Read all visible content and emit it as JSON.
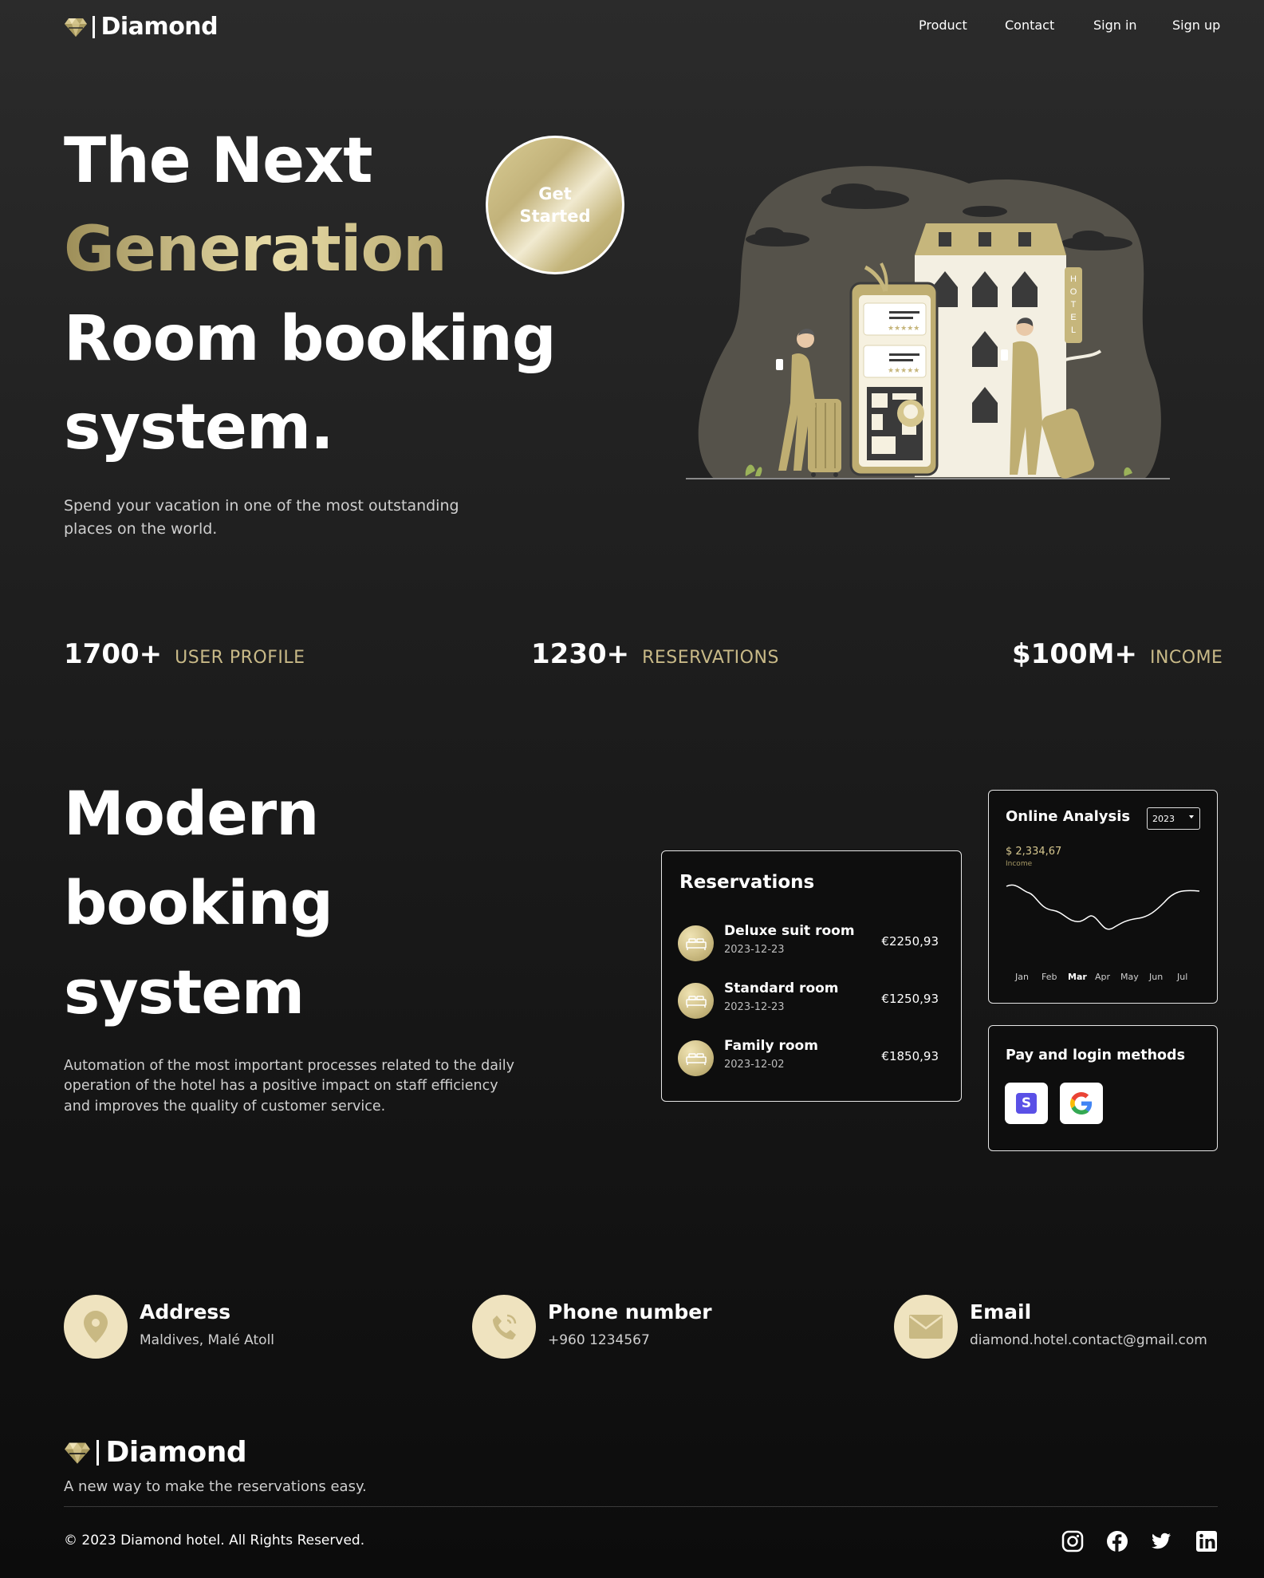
{
  "nav": {
    "brand": "Diamond",
    "links": [
      "Product",
      "Contact",
      "Sign in",
      "Sign up"
    ]
  },
  "hero": {
    "line1": "The Next",
    "line2": "Generation",
    "line3": "Room booking",
    "line4": "system.",
    "cta": "Get Started",
    "subtitle_line1": "Spend your vacation in one of the most outstanding",
    "subtitle_line2": "places on the world.",
    "illustration_sign": "HOTEL"
  },
  "stats": [
    {
      "value": "1700+",
      "label": "USER PROFILE"
    },
    {
      "value": "1230+",
      "label": "RESERVATIONS"
    },
    {
      "value": "$100M+",
      "label": "INCOME"
    }
  ],
  "features": {
    "line1": "Modern",
    "line2": "booking",
    "line3": "system",
    "desc_line1": "Automation of the most important processes related to the daily",
    "desc_line2": "operation of the hotel has a positive impact on staff efficiency",
    "desc_line3": "and improves the quality of customer service."
  },
  "reservations": {
    "title": "Reservations",
    "items": [
      {
        "name": "Deluxe suit room",
        "date": "2023-12-23",
        "price": "€2250,93"
      },
      {
        "name": "Standard room",
        "date": "2023-12-23",
        "price": "€1250,93"
      },
      {
        "name": "Family room",
        "date": "2023-12-02",
        "price": "€1850,93"
      }
    ]
  },
  "analysis": {
    "title": "Online Analysis",
    "year": "2023",
    "amount": "$ 2,334,67",
    "amount_label": "Income",
    "months": [
      "Jan",
      "Feb",
      "Mar",
      "Apr",
      "May",
      "Jun",
      "Jul"
    ],
    "active_month": "Mar"
  },
  "payments": {
    "title": "Pay and login methods",
    "methods": [
      "stripe-icon",
      "google-icon"
    ]
  },
  "contact": [
    {
      "title": "Address",
      "value": "Maldives, Malé Atoll"
    },
    {
      "title": "Phone number",
      "value": "+960 1234567"
    },
    {
      "title": "Email",
      "value": "diamond.hotel.contact@gmail.com"
    }
  ],
  "footer": {
    "brand": "Diamond",
    "tagline": "A new way to make the reservations easy.",
    "copyright": "© 2023 Diamond hotel. All Rights Reserved.",
    "socials": [
      "instagram-icon",
      "facebook-icon",
      "twitter-icon",
      "linkedin-icon"
    ]
  },
  "colors": {
    "gold": "#c8b987",
    "gold_light": "#efe3bf",
    "background": "#1c1c1c"
  }
}
